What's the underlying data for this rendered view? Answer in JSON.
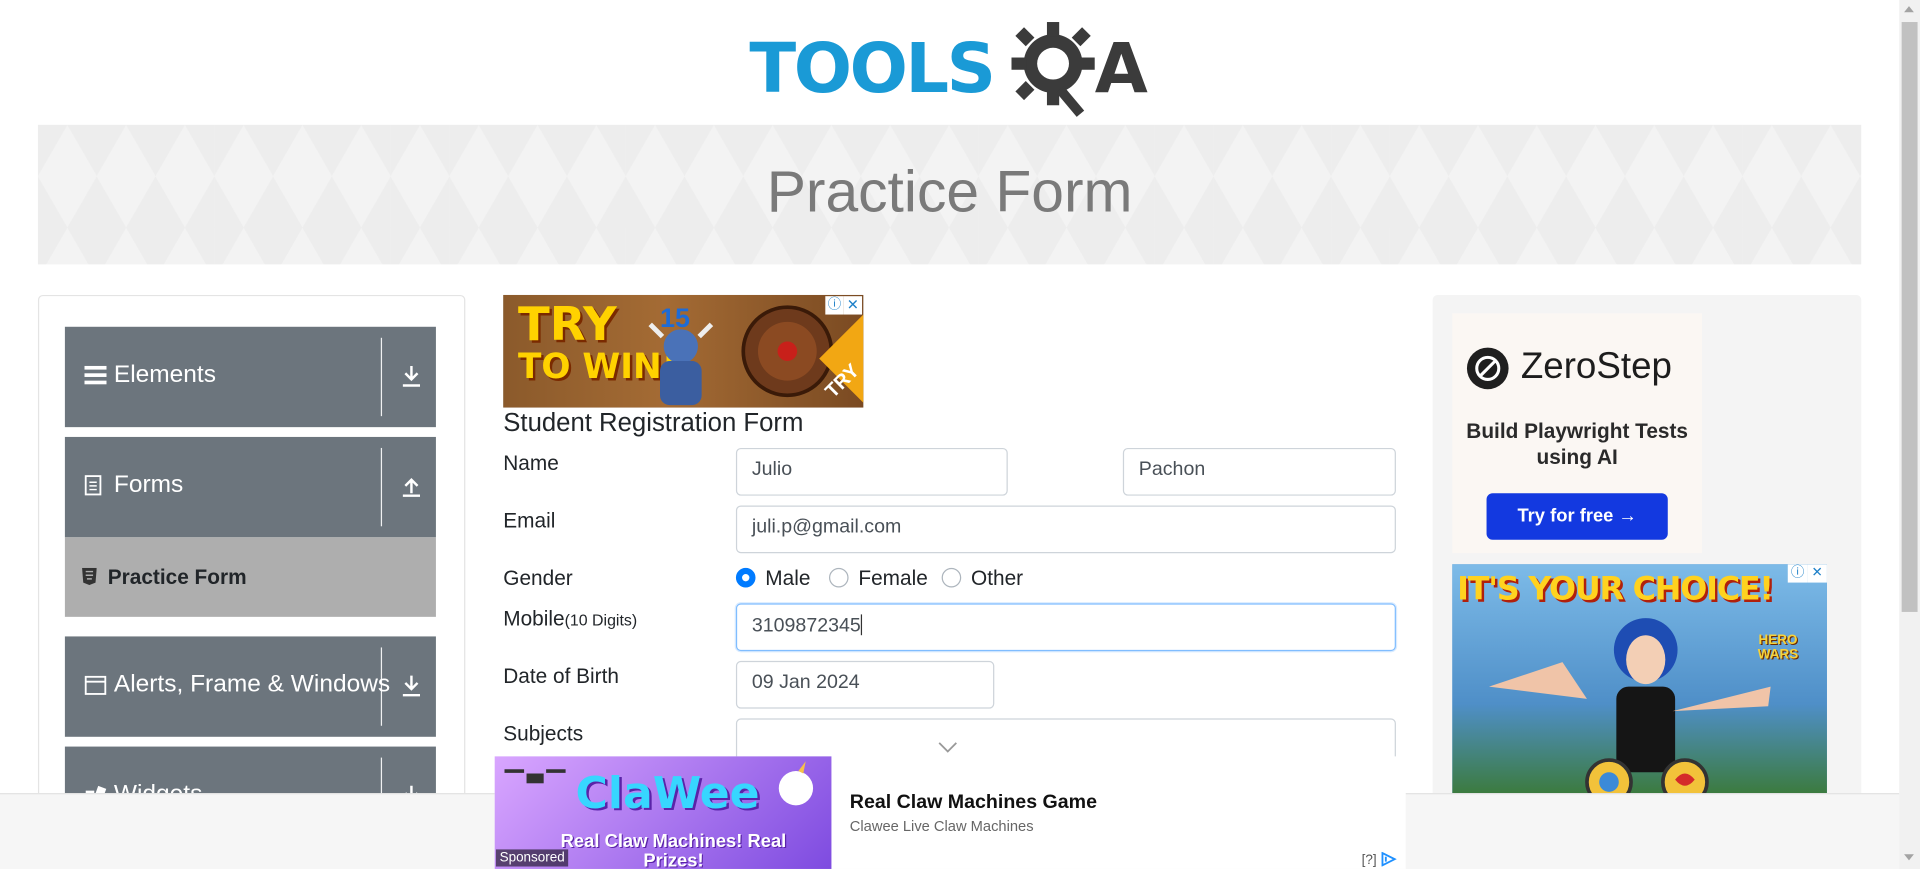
{
  "header": {
    "logo_main": "TOOLS",
    "logo_suffix": "A"
  },
  "banner": {
    "title": "Practice Form"
  },
  "sidebar": {
    "groups": [
      {
        "label": "Elements",
        "icon": "hamburger-icon",
        "arrow": "download-arrow-icon"
      },
      {
        "label": "Forms",
        "icon": "document-icon",
        "arrow": "upload-arrow-icon"
      },
      {
        "label": "Alerts, Frame & Windows",
        "icon": "window-icon",
        "arrow": "download-arrow-icon"
      },
      {
        "label": "Widgets",
        "icon": "widget-icon",
        "arrow": "download-arrow-icon"
      }
    ],
    "subitem": {
      "label": "Practice Form",
      "icon": "html5-icon"
    }
  },
  "form": {
    "title": "Student Registration Form",
    "name_label": "Name",
    "first_name": "Julio",
    "last_name": "Pachon",
    "email_label": "Email",
    "email": "juli.p@gmail.com",
    "gender_label": "Gender",
    "genders": [
      "Male",
      "Female",
      "Other"
    ],
    "gender_selected": "Male",
    "mobile_label": "Mobile",
    "mobile_hint": "(10 Digits)",
    "mobile": "3109872345",
    "dob_label": "Date of Birth",
    "dob": "09 Jan 2024",
    "subjects_label": "Subjects"
  },
  "ads": {
    "top_ad": {
      "line1": "TRY",
      "line2": "TO WIN!",
      "number": "15",
      "corner": "TRY"
    },
    "zerostep": {
      "name": "ZeroStep",
      "tagline": "Build Playwright Tests using AI",
      "button": "Try for free →"
    },
    "hero": {
      "title": "IT'S YOUR CHOICE!",
      "brand": "HERO WARS"
    },
    "bottom": {
      "title": "Real Claw Machines Game",
      "subtitle": "Clawee Live Claw Machines",
      "brand": "ClaWee",
      "image_text": "Real Claw Machines! Real Prizes!",
      "sponsored": "Sponsored",
      "adchoice": "[?]"
    }
  },
  "colors": {
    "accent": "#007bff",
    "sidebar_group": "#6c757d",
    "sidebar_active": "#aeaeae",
    "logo_blue": "#1a9ad6"
  }
}
